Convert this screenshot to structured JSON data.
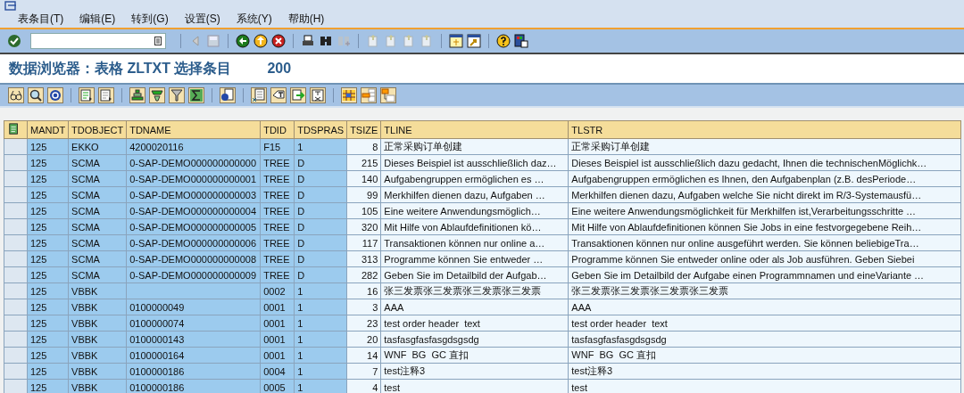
{
  "menu": [
    "表条目(T)",
    "编辑(E)",
    "转到(G)",
    "设置(S)",
    "系统(Y)",
    "帮助(H)"
  ],
  "title": {
    "text": "数据浏览器：表格 ZLTXT 选择条目",
    "count": "200"
  },
  "table": {
    "columns": [
      {
        "label": "MANDT",
        "key": true,
        "numeric": false
      },
      {
        "label": "TDOBJECT",
        "key": true,
        "numeric": false
      },
      {
        "label": "TDNAME",
        "key": true,
        "numeric": false
      },
      {
        "label": "TDID",
        "key": true,
        "numeric": false
      },
      {
        "label": "TDSPRAS",
        "key": true,
        "numeric": false
      },
      {
        "label": "TSIZE",
        "key": false,
        "numeric": true
      },
      {
        "label": "TLINE",
        "key": false,
        "numeric": false
      },
      {
        "label": "TLSTR",
        "key": false,
        "numeric": false
      }
    ],
    "rows": [
      [
        "125",
        "EKKO",
        "4200020116",
        "F15",
        "1",
        "8",
        "正常采购订单创建",
        "正常采购订单创建"
      ],
      [
        "125",
        "SCMA",
        "0-SAP-DEMO000000000000",
        "TREE",
        "D",
        "215",
        "Dieses Beispiel ist ausschließlich daz…",
        "Dieses Beispiel ist ausschließlich dazu gedacht, Ihnen die technischenMöglichk…"
      ],
      [
        "125",
        "SCMA",
        "0-SAP-DEMO000000000001",
        "TREE",
        "D",
        "140",
        "Aufgabengruppen ermöglichen es …",
        "Aufgabengruppen ermöglichen es Ihnen, den Aufgabenplan (z.B. desPeriode…"
      ],
      [
        "125",
        "SCMA",
        "0-SAP-DEMO000000000003",
        "TREE",
        "D",
        "99",
        "Merkhilfen dienen dazu, Aufgaben …",
        "Merkhilfen dienen dazu, Aufgaben welche Sie nicht direkt im R/3-Systemausfü…"
      ],
      [
        "125",
        "SCMA",
        "0-SAP-DEMO000000000004",
        "TREE",
        "D",
        "105",
        "Eine weitere Anwendungsmöglich…",
        "Eine weitere Anwendungsmöglichkeit für Merkhilfen ist,Verarbeitungsschritte …"
      ],
      [
        "125",
        "SCMA",
        "0-SAP-DEMO000000000005",
        "TREE",
        "D",
        "320",
        "Mit Hilfe von Ablaufdefinitionen kö…",
        "Mit Hilfe von Ablaufdefinitionen können Sie Jobs in eine festvorgegebene Reih…"
      ],
      [
        "125",
        "SCMA",
        "0-SAP-DEMO000000000006",
        "TREE",
        "D",
        "117",
        "Transaktionen können nur online a…",
        "Transaktionen können nur online ausgeführt werden. Sie können beliebigeTra…"
      ],
      [
        "125",
        "SCMA",
        "0-SAP-DEMO000000000008",
        "TREE",
        "D",
        "313",
        "Programme können Sie entweder …",
        "Programme können Sie entweder online oder als Job ausführen. Geben Siebei"
      ],
      [
        "125",
        "SCMA",
        "0-SAP-DEMO000000000009",
        "TREE",
        "D",
        "282",
        "Geben Sie im Detailbild der Aufgab…",
        "Geben Sie im Detailbild der Aufgabe einen Programmnamen und eineVariante …"
      ],
      [
        "125",
        "VBBK",
        "",
        "0002",
        "1",
        "16",
        "张三发票张三发票张三发票张三发票",
        "张三发票张三发票张三发票张三发票"
      ],
      [
        "125",
        "VBBK",
        "0100000049",
        "0001",
        "1",
        "3",
        "AAA",
        "AAA"
      ],
      [
        "125",
        "VBBK",
        "0100000074",
        "0001",
        "1",
        "23",
        "test order header  text",
        "test order header  text"
      ],
      [
        "125",
        "VBBK",
        "0100000143",
        "0001",
        "1",
        "20",
        "tasfasgfasfasgdsgsdg",
        "tasfasgfasfasgdsgsdg"
      ],
      [
        "125",
        "VBBK",
        "0100000164",
        "0001",
        "1",
        "14",
        "WNF  BG  GC 直扣",
        "WNF  BG  GC 直扣"
      ],
      [
        "125",
        "VBBK",
        "0100000186",
        "0004",
        "1",
        "7",
        "test注释3",
        "test注释3"
      ],
      [
        "125",
        "VBBK",
        "0100000186",
        "0005",
        "1",
        "4",
        "test",
        "test"
      ]
    ]
  }
}
